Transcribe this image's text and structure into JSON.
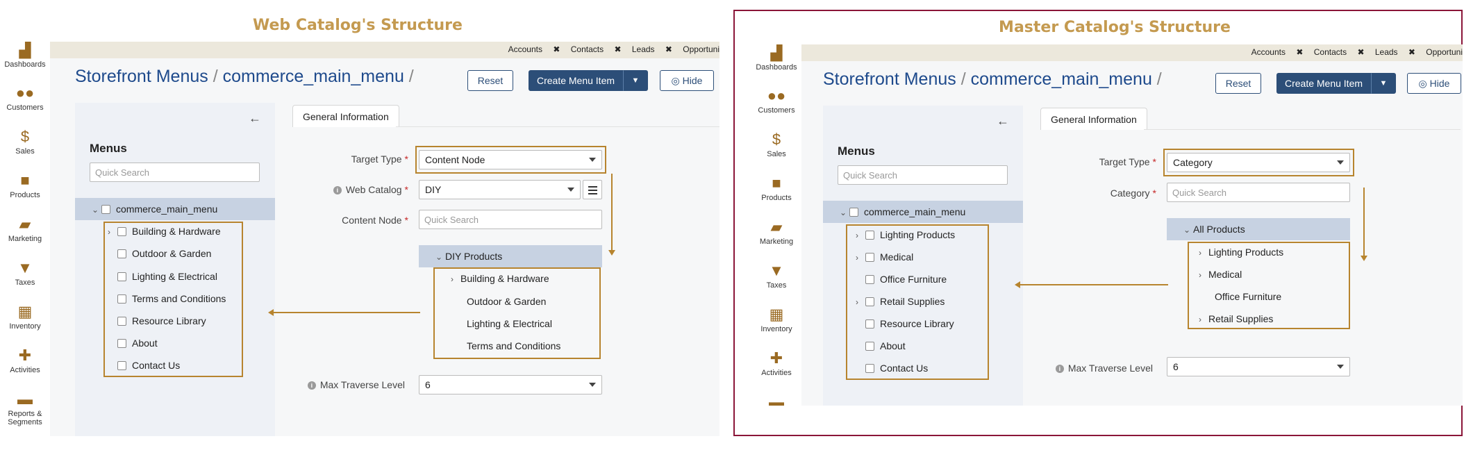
{
  "web": {
    "heading": "Web Catalog's Structure",
    "topbar_tabs": [
      "Accounts",
      "Contacts",
      "Leads",
      "Opportuni"
    ],
    "nav": [
      {
        "label": "Dashboards",
        "icon": "dashboards-icon"
      },
      {
        "label": "Customers",
        "icon": "customers-icon"
      },
      {
        "label": "Sales",
        "icon": "sales-icon"
      },
      {
        "label": "Products",
        "icon": "products-icon"
      },
      {
        "label": "Marketing",
        "icon": "marketing-icon"
      },
      {
        "label": "Taxes",
        "icon": "taxes-icon"
      },
      {
        "label": "Inventory",
        "icon": "inventory-icon"
      },
      {
        "label": "Activities",
        "icon": "activities-icon"
      },
      {
        "label": "Reports & Segments",
        "icon": "reports-icon"
      }
    ],
    "breadcrumb": {
      "part1": "Storefront Menus",
      "sep": "/",
      "part2": "commerce_main_menu",
      "sep2": "/"
    },
    "buttons": {
      "reset": "Reset",
      "create": "Create Menu Item",
      "hide": "Hide"
    },
    "menus": {
      "title": "Menus",
      "search_placeholder": "Quick Search",
      "root": "commerce_main_menu",
      "items": [
        "Building & Hardware",
        "Outdoor & Garden",
        "Lighting & Electrical",
        "Terms and Conditions",
        "Resource Library",
        "About",
        "Contact Us"
      ]
    },
    "tab": "General Information",
    "form": {
      "target_type_label": "Target Type",
      "target_type_value": "Content Node",
      "web_catalog_label": "Web Catalog",
      "web_catalog_value": "DIY",
      "content_node_label": "Content Node",
      "content_node_placeholder": "Quick Search",
      "tree_root": "DIY Products",
      "tree_items": [
        "Building & Hardware",
        "Outdoor & Garden",
        "Lighting & Electrical",
        "Terms and Conditions"
      ],
      "max_label": "Max Traverse Level",
      "max_value": "6"
    }
  },
  "master": {
    "heading": "Master Catalog's Structure",
    "topbar_tabs": [
      "Accounts",
      "Contacts",
      "Leads",
      "Opportuni"
    ],
    "nav": [
      {
        "label": "Dashboards",
        "icon": "dashboards-icon"
      },
      {
        "label": "Customers",
        "icon": "customers-icon"
      },
      {
        "label": "Sales",
        "icon": "sales-icon"
      },
      {
        "label": "Products",
        "icon": "products-icon"
      },
      {
        "label": "Marketing",
        "icon": "marketing-icon"
      },
      {
        "label": "Taxes",
        "icon": "taxes-icon"
      },
      {
        "label": "Inventory",
        "icon": "inventory-icon"
      },
      {
        "label": "Activities",
        "icon": "activities-icon"
      }
    ],
    "breadcrumb": {
      "part1": "Storefront Menus",
      "sep": "/",
      "part2": "commerce_main_menu",
      "sep2": "/"
    },
    "buttons": {
      "reset": "Reset",
      "create": "Create Menu Item",
      "hide": "Hide"
    },
    "menus": {
      "title": "Menus",
      "search_placeholder": "Quick Search",
      "root": "commerce_main_menu",
      "items": [
        "Lighting Products",
        "Medical",
        "Office Furniture",
        "Retail Supplies",
        "Resource Library",
        "About",
        "Contact Us"
      ]
    },
    "tab": "General Information",
    "form": {
      "target_type_label": "Target Type",
      "target_type_value": "Category",
      "category_label": "Category",
      "category_placeholder": "Quick Search",
      "tree_root": "All Products",
      "tree_items": [
        "Lighting Products",
        "Medical",
        "Office Furniture",
        "Retail Supplies"
      ],
      "max_label": "Max Traverse Level",
      "max_value": "6"
    }
  },
  "colors": {
    "accent": "#b7842e",
    "brand_blue": "#1e4a8c",
    "button_blue": "#2c4e78",
    "frame": "#8a1538"
  }
}
